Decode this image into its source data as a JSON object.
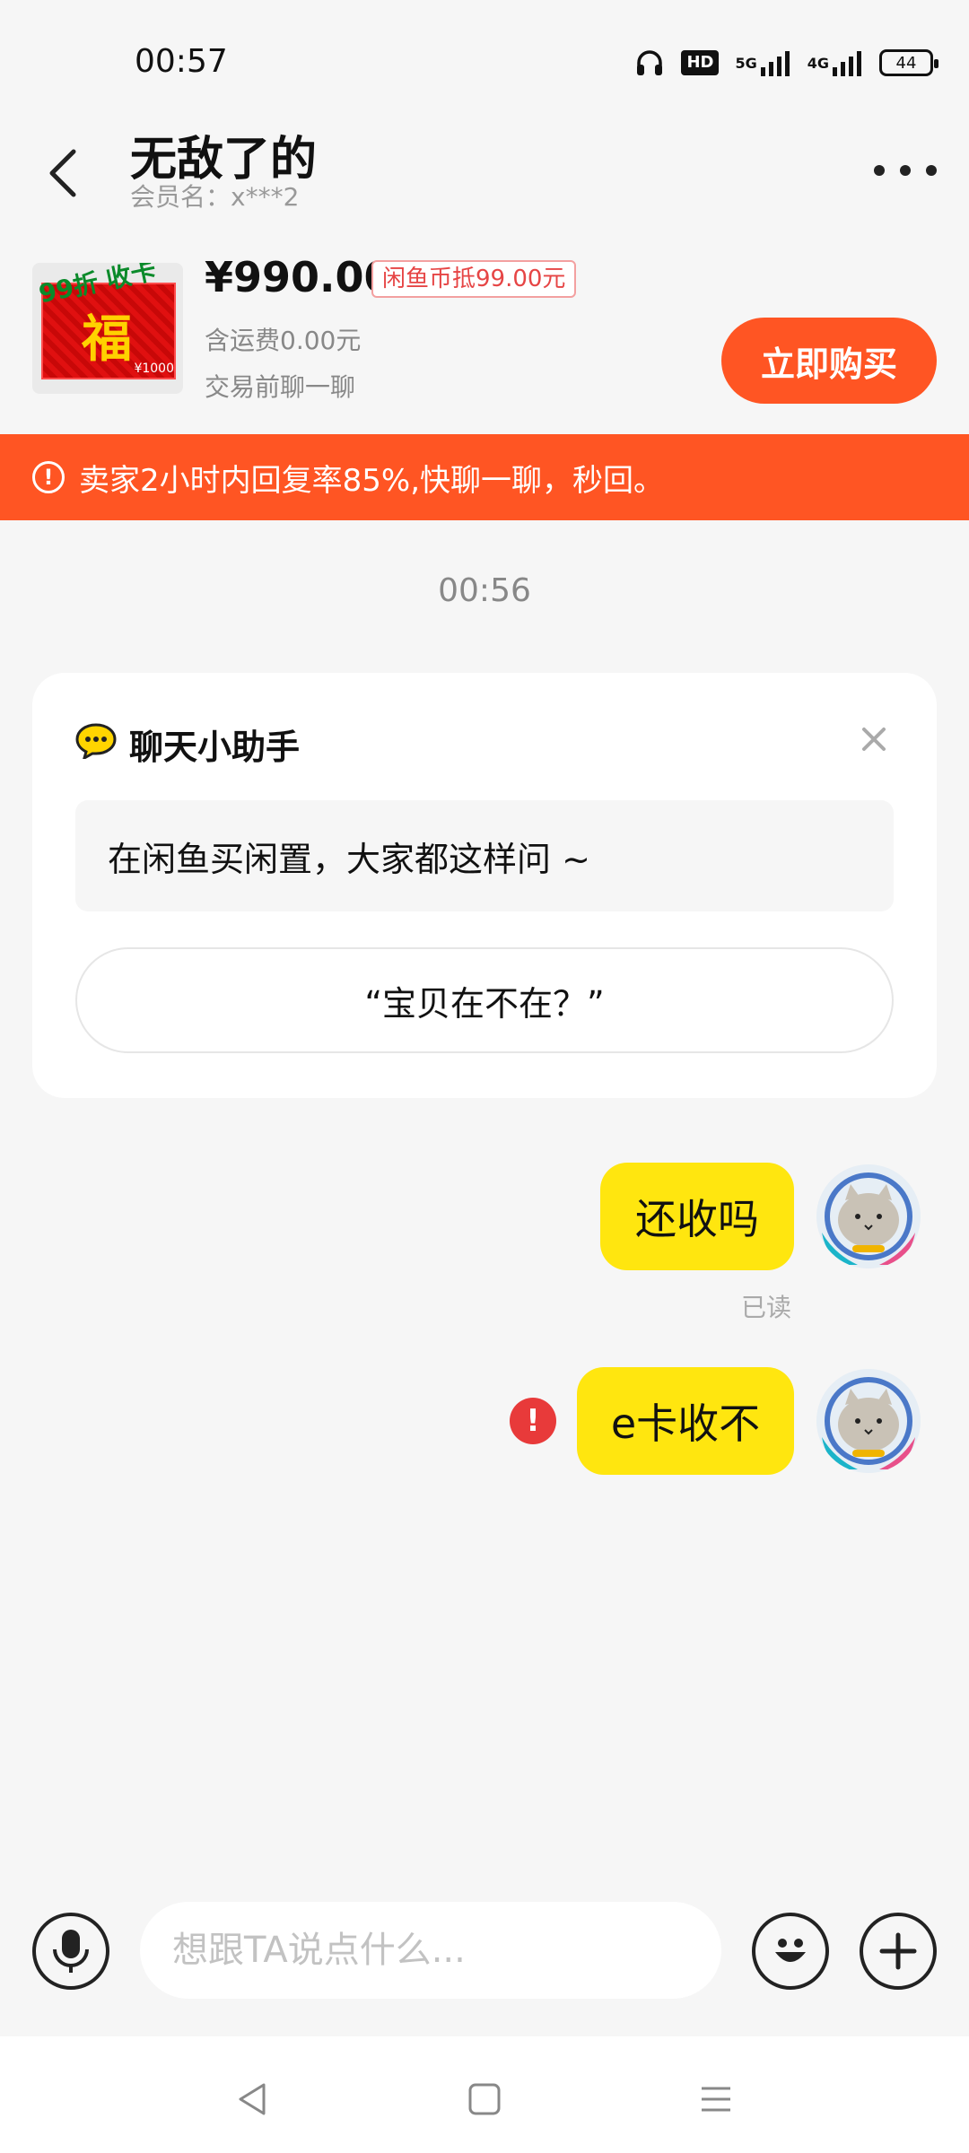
{
  "status_bar": {
    "time": "00:57",
    "hd_label": "HD",
    "network_5g": "5G",
    "network_4g": "4G",
    "battery": "44"
  },
  "header": {
    "title": "无敌了的",
    "member_label": "会员名：x***2"
  },
  "product": {
    "image_tag": "99折 收卡",
    "image_char": "福",
    "image_amount": "¥1000",
    "price": "¥990.00",
    "coin_discount": "闲鱼币抵99.00元",
    "shipping": "含运费0.00元",
    "chat_before": "交易前聊一聊",
    "buy_label": "立即购买"
  },
  "banner": {
    "icon": "!",
    "text": "卖家2小时内回复率85%,快聊一聊，秒回。"
  },
  "chat_time": "00:56",
  "assistant": {
    "title": "聊天小助手",
    "hint": "在闲鱼买闲置，大家都这样问 ~",
    "suggestion": "“宝贝在不在？”"
  },
  "messages": [
    {
      "text": "还收吗",
      "status": "已读"
    },
    {
      "text": "e卡收不",
      "error_icon": "!"
    }
  ],
  "input": {
    "placeholder": "想跟TA说点什么..."
  },
  "colors": {
    "accent_orange": "#ff5523",
    "bubble_yellow": "#ffe60f",
    "error_red": "#e83a3a"
  },
  "icons": [
    "back-arrow-icon",
    "more-icon",
    "alert-icon",
    "chat-bubble-icon",
    "close-icon",
    "error-icon",
    "mic-icon",
    "emoji-icon",
    "plus-icon",
    "nav-back-icon",
    "nav-home-icon",
    "nav-menu-icon"
  ]
}
